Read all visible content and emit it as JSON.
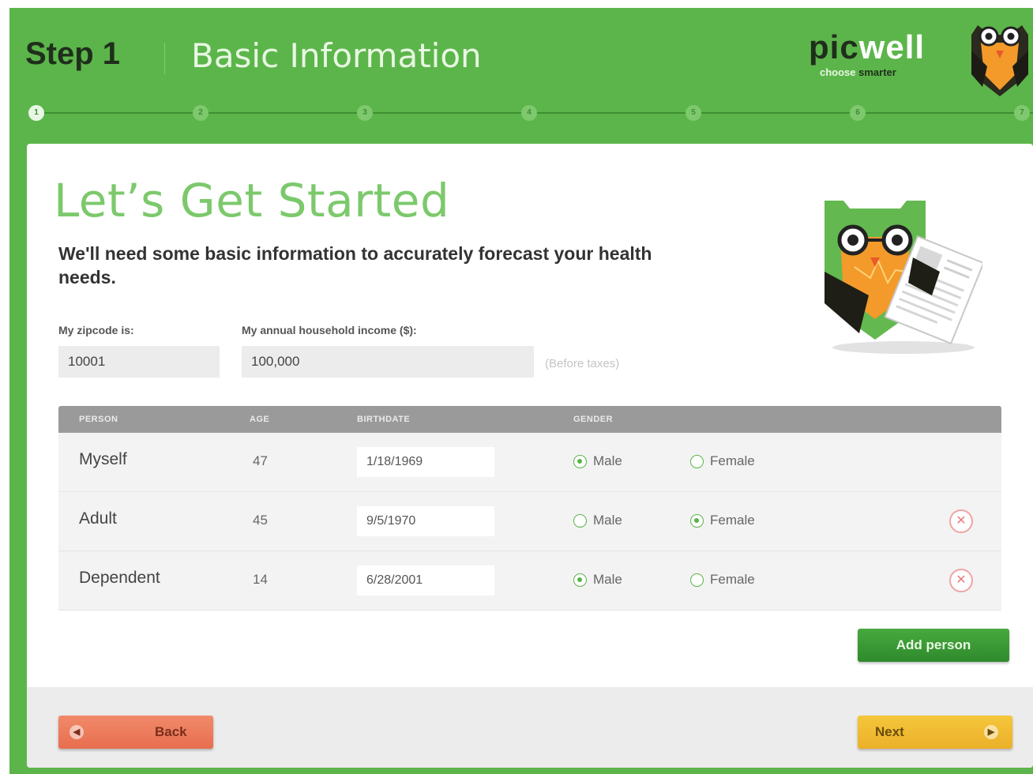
{
  "header": {
    "step_word": "Step 1",
    "step_title": "Basic Information",
    "logo_pic": "pic",
    "logo_well": "well",
    "logo_tag_a": "choose",
    "logo_tag_b": "smarter"
  },
  "progress": {
    "steps": [
      "1",
      "2",
      "3",
      "4",
      "5",
      "6",
      "7"
    ],
    "current": 1
  },
  "main": {
    "heading": "Let’s Get Started",
    "subheading": "We'll need some basic information to accurately forecast your health needs."
  },
  "form": {
    "zip_label": "My zipcode is:",
    "zip_value": "10001",
    "income_label": "My annual household income ($):",
    "income_value": "100,000",
    "income_note": "(Before taxes)"
  },
  "table": {
    "headers": [
      "PERSON",
      "AGE",
      "BIRTHDATE",
      "GENDER"
    ],
    "rows": [
      {
        "person": "Myself",
        "age": "47",
        "birthdate": "1/18/1969",
        "male_label": "Male",
        "female_label": "Female",
        "gender": "Male",
        "removable": false
      },
      {
        "person": "Adult",
        "age": "45",
        "birthdate": "9/5/1970",
        "male_label": "Male",
        "female_label": "Female",
        "gender": "Female",
        "removable": true
      },
      {
        "person": "Dependent",
        "age": "14",
        "birthdate": "6/28/2001",
        "male_label": "Male",
        "female_label": "Female",
        "gender": "Male",
        "removable": true
      }
    ],
    "remove_icon": "close-icon"
  },
  "actions": {
    "add_person": "Add person",
    "back": "Back",
    "next": "Next"
  },
  "colors": {
    "brand_green": "#5cb54a",
    "heading_green": "#7cc96c",
    "back_orange": "#e76e4f",
    "next_yellow": "#ebb02a"
  }
}
